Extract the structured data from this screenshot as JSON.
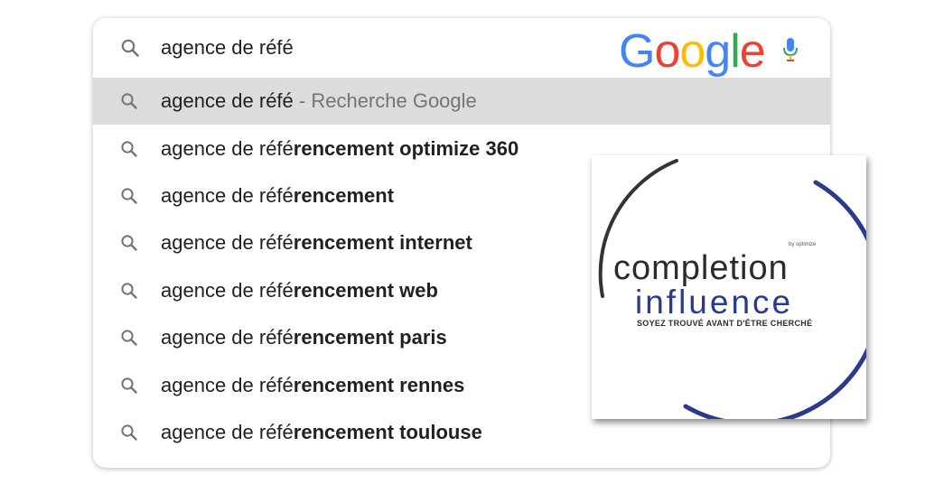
{
  "search": {
    "query": "agence de réfé",
    "logo_letters": [
      {
        "char": "G",
        "color": "#4285f4"
      },
      {
        "char": "o",
        "color": "#ea4335"
      },
      {
        "char": "o",
        "color": "#fbbc05"
      },
      {
        "char": "g",
        "color": "#4285f4"
      },
      {
        "char": "l",
        "color": "#34a853"
      },
      {
        "char": "e",
        "color": "#ea4335"
      }
    ],
    "icons": {
      "search": "search-icon",
      "mic": "microphone-icon"
    }
  },
  "suggestions": [
    {
      "prefix": "agence de réfé",
      "bold": "",
      "suffix": " - Recherche Google",
      "highlighted": true
    },
    {
      "prefix": "agence de réfé",
      "bold": "rencement optimize 360",
      "suffix": "",
      "highlighted": false
    },
    {
      "prefix": "agence de réfé",
      "bold": "rencement",
      "suffix": "",
      "highlighted": false
    },
    {
      "prefix": "agence de réfé",
      "bold": "rencement internet",
      "suffix": "",
      "highlighted": false
    },
    {
      "prefix": "agence de réfé",
      "bold": "rencement web",
      "suffix": "",
      "highlighted": false
    },
    {
      "prefix": "agence de réfé",
      "bold": "rencement paris",
      "suffix": "",
      "highlighted": false
    },
    {
      "prefix": "agence de réfé",
      "bold": "rencement rennes",
      "suffix": "",
      "highlighted": false
    },
    {
      "prefix": "agence de réfé",
      "bold": "rencement toulouse",
      "suffix": "",
      "highlighted": false
    }
  ],
  "brand": {
    "line1": "completion",
    "line2": "influence",
    "tagline": "SOYEZ TROUVÉ AVANT D'ÊTRE CHERCHÉ",
    "by": "by optimize",
    "arc_dark": "#333333",
    "arc_blue": "#2a3a8c"
  }
}
